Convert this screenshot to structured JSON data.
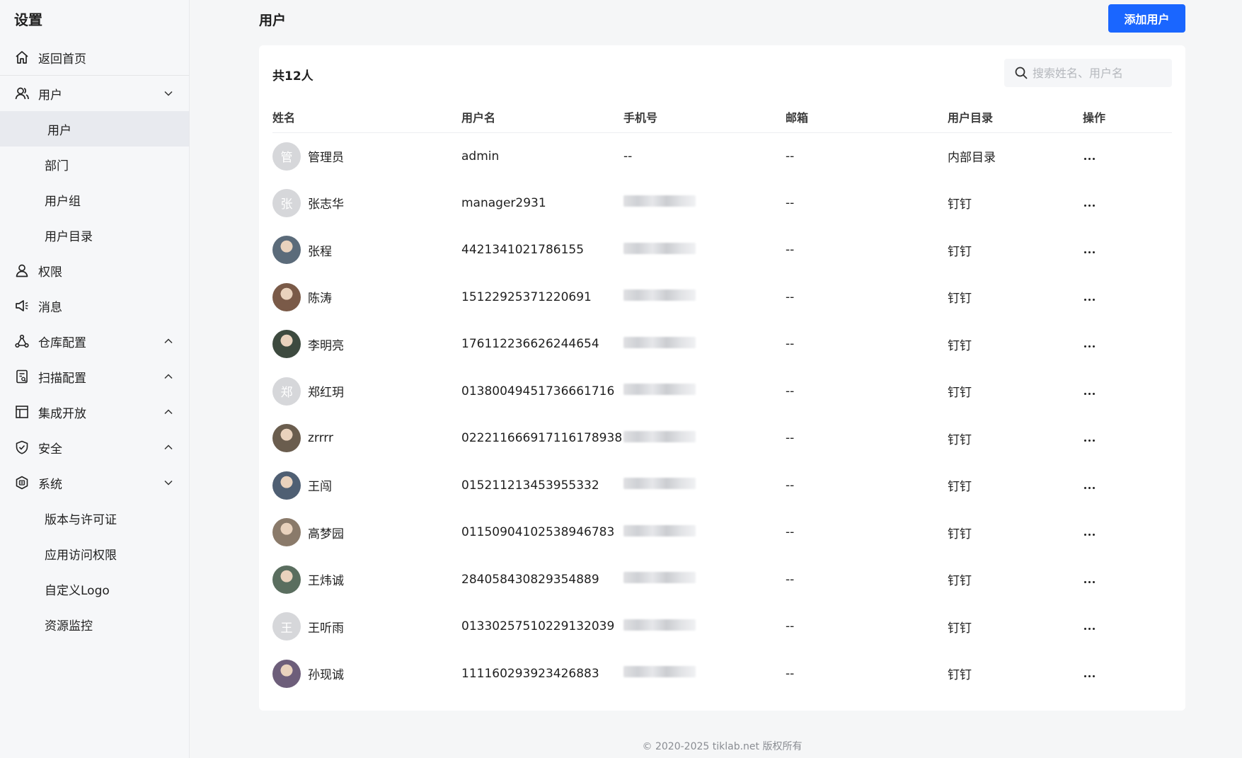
{
  "sidebar": {
    "title": "设置",
    "home": "返回首页",
    "user_group": {
      "label": "用户",
      "expanded": true
    },
    "user_sub": [
      "用户",
      "部门",
      "用户组",
      "用户目录"
    ],
    "permission": "权限",
    "message": "消息",
    "repo_config": "仓库配置",
    "scan_config": "扫描配置",
    "integration": "集成开放",
    "security": "安全",
    "system": {
      "label": "系统",
      "expanded": true
    },
    "system_sub": [
      "版本与许可证",
      "应用访问权限",
      "自定义Logo",
      "资源监控"
    ]
  },
  "main": {
    "title": "用户",
    "add_button": "添加用户",
    "count": "共12人",
    "search_placeholder": "搜索姓名、用户名",
    "columns": [
      "姓名",
      "用户名",
      "手机号",
      "邮箱",
      "用户目录",
      "操作"
    ],
    "rows": [
      {
        "avatar": "管",
        "avatar_type": "letter",
        "name": "管理员",
        "username": "admin",
        "phone": "--",
        "phone_blurred": false,
        "email": "--",
        "directory": "内部目录"
      },
      {
        "avatar": "张",
        "avatar_type": "letter",
        "name": "张志华",
        "username": "manager2931",
        "phone": "",
        "phone_blurred": true,
        "email": "--",
        "directory": "钉钉"
      },
      {
        "avatar": "",
        "avatar_type": "photo",
        "name": "张程",
        "username": "4421341021786155",
        "phone": "",
        "phone_blurred": true,
        "email": "--",
        "directory": "钉钉"
      },
      {
        "avatar": "",
        "avatar_type": "photo",
        "name": "陈涛",
        "username": "15122925371220691",
        "phone": "",
        "phone_blurred": true,
        "email": "--",
        "directory": "钉钉"
      },
      {
        "avatar": "",
        "avatar_type": "photo",
        "name": "李明亮",
        "username": "176112236626244654",
        "phone": "",
        "phone_blurred": true,
        "email": "--",
        "directory": "钉钉"
      },
      {
        "avatar": "郑",
        "avatar_type": "letter",
        "name": "郑红玥",
        "username": "01380049451736661716",
        "phone": "",
        "phone_blurred": true,
        "email": "--",
        "directory": "钉钉"
      },
      {
        "avatar": "",
        "avatar_type": "photo",
        "name": "zrrrr",
        "username": "022211666917116178938",
        "phone": "",
        "phone_blurred": true,
        "email": "--",
        "directory": "钉钉"
      },
      {
        "avatar": "",
        "avatar_type": "photo",
        "name": "王闯",
        "username": "015211213453955332",
        "phone": "",
        "phone_blurred": true,
        "email": "--",
        "directory": "钉钉"
      },
      {
        "avatar": "",
        "avatar_type": "photo",
        "name": "高梦园",
        "username": "01150904102538946783",
        "phone": "",
        "phone_blurred": true,
        "email": "--",
        "directory": "钉钉"
      },
      {
        "avatar": "",
        "avatar_type": "photo",
        "name": "王炜诚",
        "username": "284058430829354889",
        "phone": "",
        "phone_blurred": true,
        "email": "--",
        "directory": "钉钉"
      },
      {
        "avatar": "王",
        "avatar_type": "letter",
        "name": "王听雨",
        "username": "01330257510229132039",
        "phone": "",
        "phone_blurred": true,
        "email": "--",
        "directory": "钉钉"
      },
      {
        "avatar": "",
        "avatar_type": "photo",
        "name": "孙现诚",
        "username": "111160293923426883",
        "phone": "",
        "phone_blurred": true,
        "email": "--",
        "directory": "钉钉"
      }
    ]
  },
  "footer": "© 2020-2025 tiklab.net 版权所有",
  "colors": {
    "accent": "#1a66ff",
    "sidebar_active": "#e8eaef"
  },
  "icons": [
    "home-icon",
    "user-icon",
    "chevron-down-icon",
    "chevron-up-icon",
    "key-user-icon",
    "megaphone-icon",
    "repo-icon",
    "scan-icon",
    "layout-icon",
    "shield-icon",
    "system-icon",
    "search-icon",
    "more-icon"
  ]
}
